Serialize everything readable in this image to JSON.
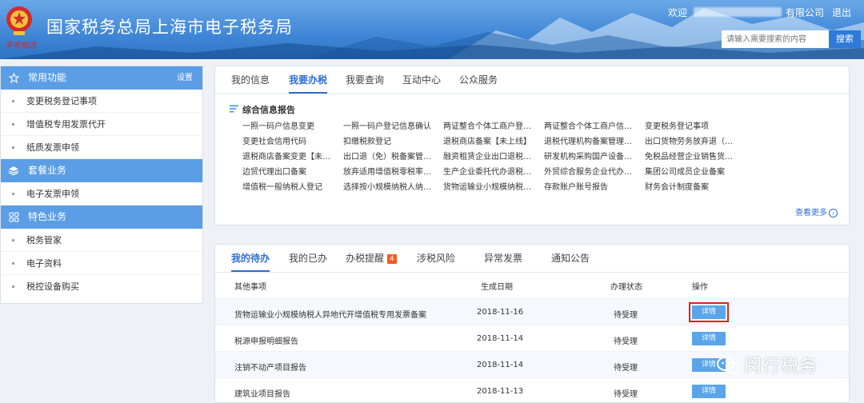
{
  "header": {
    "brand_sub": "字号标志",
    "title": "国家税务总局上海市电子税务局",
    "welcome": "欢迎",
    "company": "有限公司",
    "logout": "退出",
    "search_placeholder": "请输入需要搜索的内容",
    "search_button": "搜索"
  },
  "sidebar": {
    "common": {
      "title": "常用功能",
      "setting": "设置",
      "icon": "star-icon",
      "items": [
        "变更税务登记事项",
        "增值税专用发票代开",
        "纸质发票申领"
      ]
    },
    "package": {
      "title": "套餐业务",
      "icon": "layers-icon",
      "items": [
        "电子发票申领"
      ]
    },
    "special": {
      "title": "特色业务",
      "icon": "grid-icon",
      "items": [
        "税务管家",
        "电子资料",
        "税控设备购买"
      ]
    }
  },
  "top_panel": {
    "tabs": [
      "我的信息",
      "我要办税",
      "我要查询",
      "互动中心",
      "公众服务"
    ],
    "active_tab": "我要办税",
    "section_title": "综合信息报告",
    "items": [
      [
        "一照一码户信息变更",
        "一照一码户登记信息确认",
        "两证整合个体工商户登…",
        "两证整合个体工商户信…",
        "变更税务登记事项"
      ],
      [
        "变更社会信用代码",
        "扣缴税款登记",
        "退税商店备案【未上线】",
        "退税代理机构备案管理…",
        "出口货物劳务放弃退（…"
      ],
      [
        "退税商店备案变更【未…",
        "出口退（免）税备案管…",
        "融资租赁企业出口退税…",
        "研发机构采购国产设备…",
        "免税品经营企业销售货…"
      ],
      [
        "边贸代理出口备案",
        "放弃适用增值税零税率…",
        "生产企业委托代办退税…",
        "外贸综合服务企业代办…",
        "集团公司成员企业备案"
      ],
      [
        "增值税一般纳税人登记",
        "选择按小规模纳税人纳…",
        "货物运输业小规模纳税…",
        "存款账户账号报告",
        "财务会计制度备案"
      ]
    ],
    "more": "查看更多"
  },
  "bottom_panel": {
    "tabs": [
      "我的待办",
      "我的已办",
      "办税提醒",
      "涉税风险",
      "异常发票",
      "通知公告"
    ],
    "active_tab": "我的待办",
    "reminder_badge": "4",
    "columns": [
      "其他事项",
      "生成日期",
      "办理状态",
      "操作"
    ],
    "rows": [
      {
        "item": "货物运输业小规模纳税人异地代开增值税专用发票备案",
        "date": "2018-11-16",
        "status": "待受理",
        "action": "详情"
      },
      {
        "item": "税源申报明细报告",
        "date": "2018-11-14",
        "status": "待受理",
        "action": "详情"
      },
      {
        "item": "注销不动产项目报告",
        "date": "2018-11-14",
        "status": "待受理",
        "action": "详情"
      },
      {
        "item": "建筑业项目报告",
        "date": "2018-11-13",
        "status": "待受理",
        "action": "详情"
      }
    ]
  },
  "watermark": "闵行税务",
  "colors": {
    "primary": "#2e6fd1",
    "sidebar_head": "#5b9ee6",
    "badge": "#f25a1b",
    "highlight": "#e02020"
  }
}
